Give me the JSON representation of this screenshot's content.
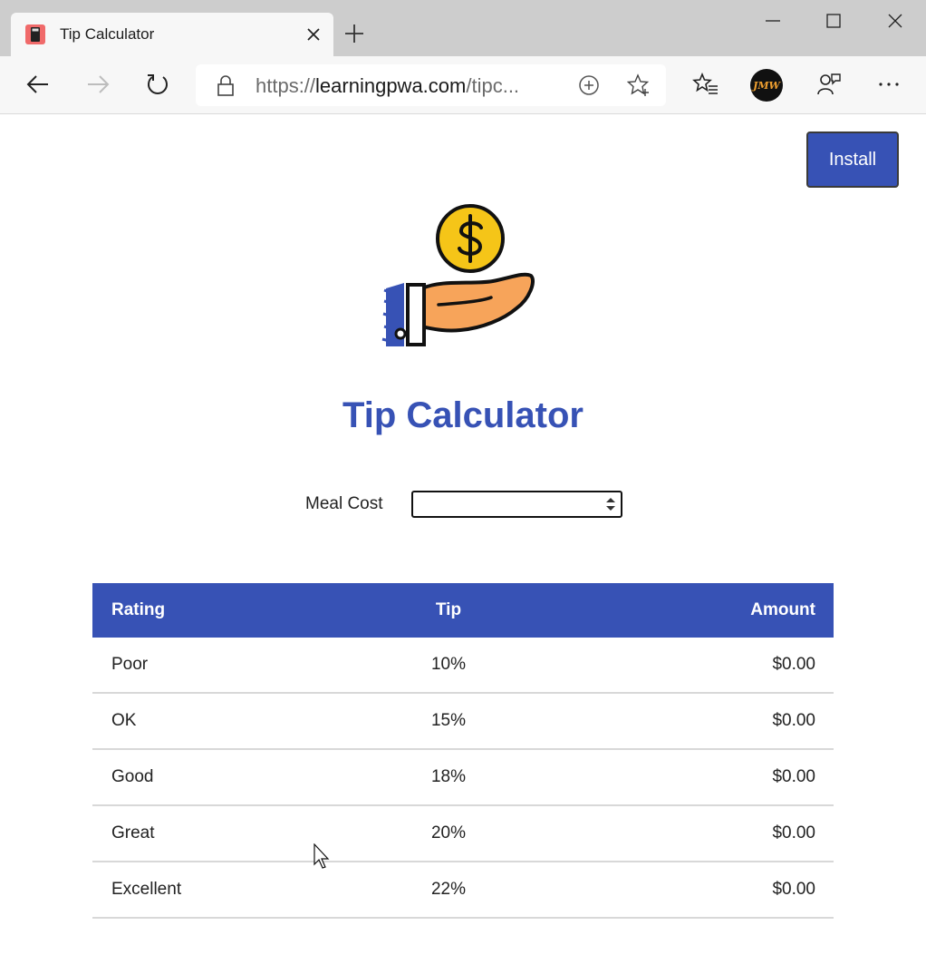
{
  "browser": {
    "tab_title": "Tip Calculator",
    "url_scheme": "https://",
    "url_host": "learningpwa.com",
    "url_path": "/tipc...",
    "avatar_initials": "JMW"
  },
  "page": {
    "install_label": "Install",
    "title": "Tip Calculator",
    "meal_cost_label": "Meal Cost",
    "meal_cost_value": ""
  },
  "table": {
    "headers": [
      "Rating",
      "Tip",
      "Amount"
    ],
    "rows": [
      {
        "rating": "Poor",
        "tip": "10%",
        "amount": "$0.00"
      },
      {
        "rating": "OK",
        "tip": "15%",
        "amount": "$0.00"
      },
      {
        "rating": "Good",
        "tip": "18%",
        "amount": "$0.00"
      },
      {
        "rating": "Great",
        "tip": "20%",
        "amount": "$0.00"
      },
      {
        "rating": "Excellent",
        "tip": "22%",
        "amount": "$0.00"
      }
    ]
  },
  "colors": {
    "accent": "#3752b5",
    "tabstrip": "#cdcdcd",
    "toolbar": "#f7f7f7",
    "coin": "#f5c518",
    "hand": "#f7a45a"
  },
  "icons": [
    "calculator-favicon-icon",
    "close-icon",
    "plus-icon",
    "minimize-icon",
    "maximize-icon",
    "window-close-icon",
    "back-arrow-icon",
    "forward-arrow-icon",
    "refresh-icon",
    "lock-icon",
    "add-circle-icon",
    "star-add-icon",
    "favorites-icon",
    "share-icon",
    "more-icon",
    "spinner-icon",
    "cursor-icon"
  ]
}
